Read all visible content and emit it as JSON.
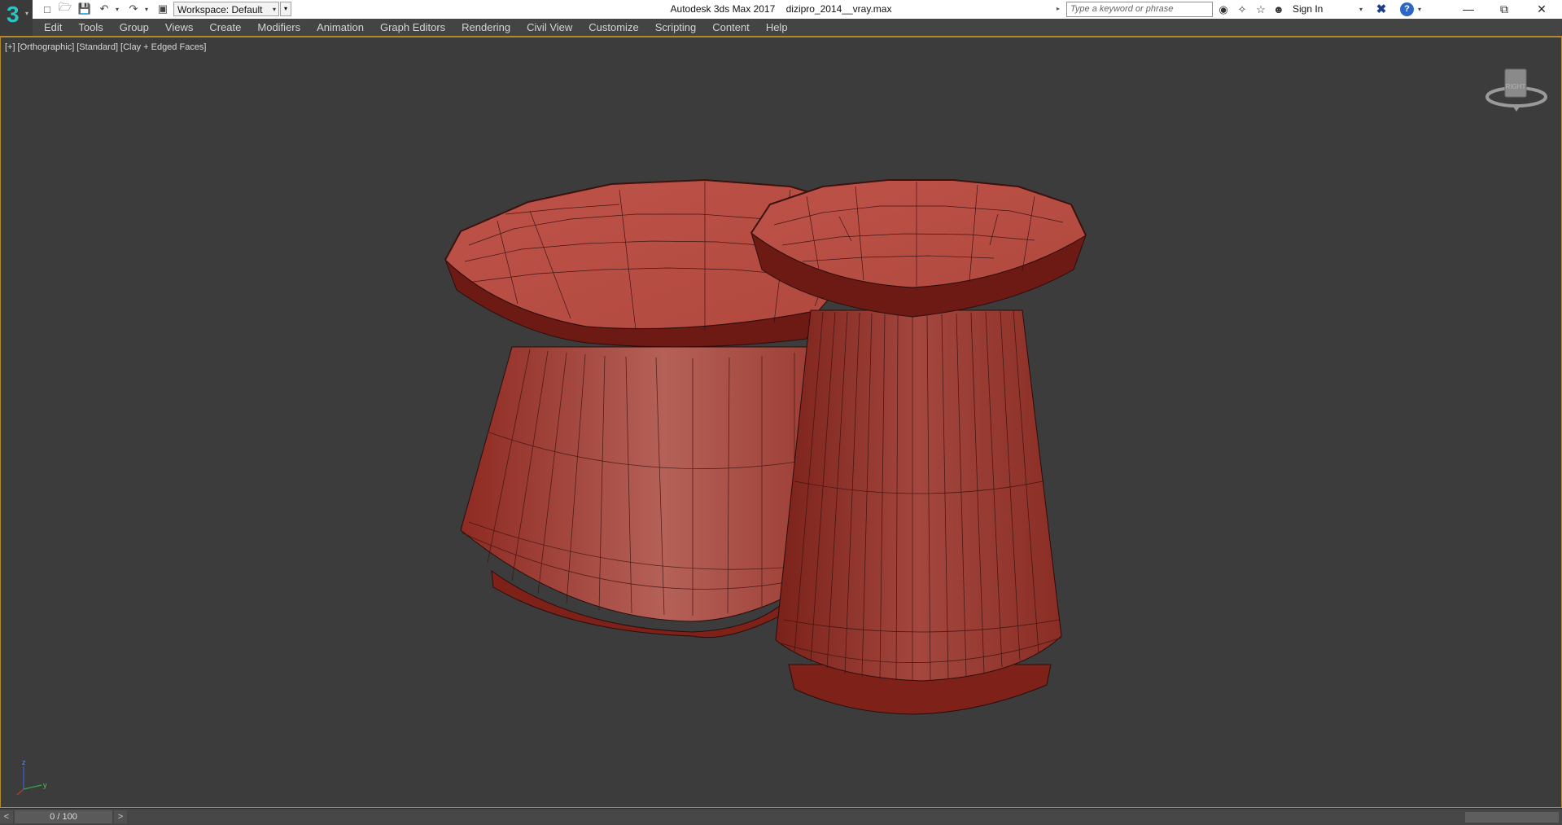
{
  "titlebar": {
    "logo_glyph": "3",
    "workspace_label": "Workspace: Default",
    "app_title": "Autodesk 3ds Max 2017",
    "file_name": "dizipro_2014__vray.max",
    "search_placeholder": "Type a keyword or phrase",
    "sign_in": "Sign In",
    "help_glyph": "?"
  },
  "menu": {
    "items": [
      "Edit",
      "Tools",
      "Group",
      "Views",
      "Create",
      "Modifiers",
      "Animation",
      "Graph Editors",
      "Rendering",
      "Civil View",
      "Customize",
      "Scripting",
      "Content",
      "Help"
    ]
  },
  "viewport": {
    "labels": [
      "[+]",
      "[Orthographic]",
      "[Standard]",
      "[Clay + Edged Faces]"
    ],
    "viewcube_face": "RIGHT",
    "axis_labels": [
      "z",
      "y"
    ],
    "object_color": "#b0463e",
    "edge_color": "#2a0d0b",
    "background_color": "#3c3c3c"
  },
  "timeline": {
    "prev": "<",
    "position": "0 / 100",
    "next": ">"
  },
  "colors": {
    "menu_bg": "#444444",
    "viewport_border": "#b08a2c",
    "accent": "#2ec4c4"
  }
}
